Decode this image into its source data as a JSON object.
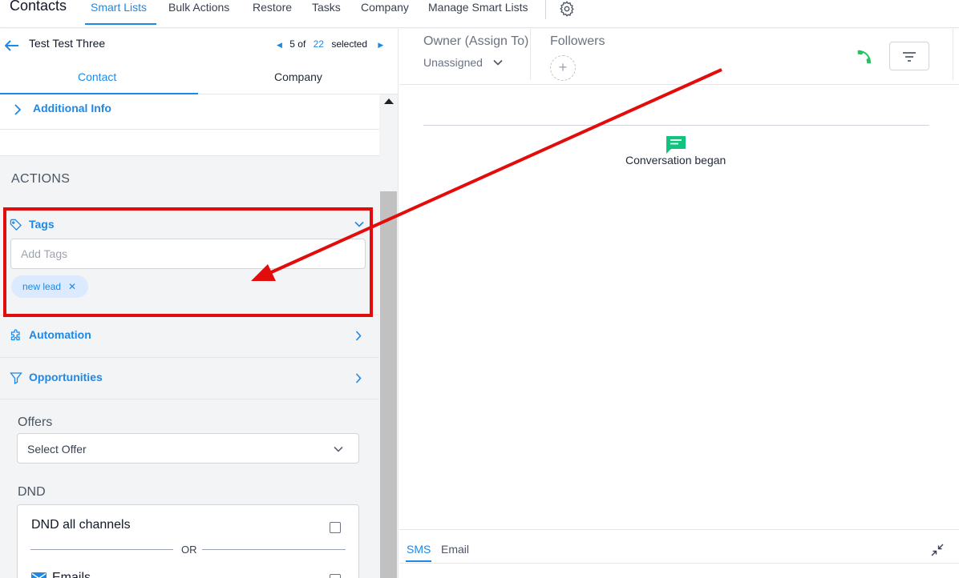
{
  "nav": {
    "title": "Contacts",
    "tabs": [
      "Smart Lists",
      "Bulk Actions",
      "Restore",
      "Tasks",
      "Company",
      "Manage Smart Lists"
    ]
  },
  "contact": {
    "name": "Test Test Three",
    "pager_current": "5 of",
    "pager_total": "22",
    "pager_suffix": "selected"
  },
  "subtabs": [
    "Contact",
    "Company"
  ],
  "sections": {
    "additional_info": "Additional Info",
    "actions_heading": "ACTIONS",
    "tags_label": "Tags",
    "tags_placeholder": "Add Tags",
    "tag_chip": "new lead",
    "automation": "Automation",
    "opportunities": "Opportunities"
  },
  "offers": {
    "label": "Offers",
    "select_value": "Select Offer"
  },
  "dnd": {
    "label": "DND",
    "all_channels": "DND all channels",
    "or_text": "OR",
    "emails": "Emails"
  },
  "right": {
    "owner_label": "Owner (Assign To)",
    "owner_value": "Unassigned",
    "followers_label": "Followers",
    "add_follower": "+",
    "conversation_began": "Conversation began",
    "composer_tabs": [
      "SMS",
      "Email"
    ]
  },
  "colors": {
    "accent": "#1e88e5",
    "highlight": "#e30c0c",
    "phone": "#22c55e",
    "conversation_icon": "#10c37e"
  }
}
